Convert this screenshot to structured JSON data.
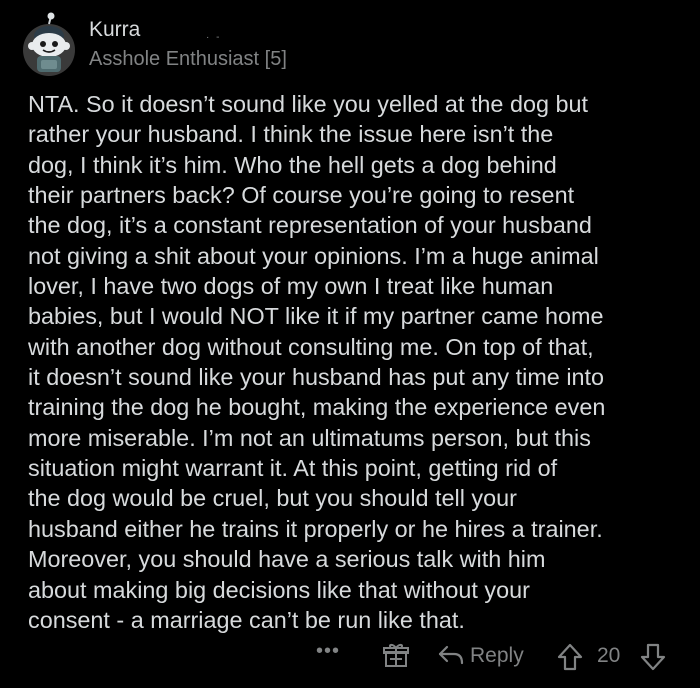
{
  "comment": {
    "author": "Kurra",
    "author_extra": "·  ‐",
    "flair": "Asshole Enthusiast [5]",
    "body_lines": [
      "NTA. So it doesn’t sound like you yelled at the dog but",
      "rather your husband. I think the issue here isn’t the",
      "dog, I think it’s him. Who the hell gets a dog behind",
      "their partners back? Of course you’re going to resent",
      "the dog, it’s a constant representation of your husband",
      "not giving a shit about your opinions. I’m a huge animal",
      "lover, I have two dogs of my own I treat like human",
      "babies, but I would NOT like it if my partner came home",
      "with another dog without consulting me. On top of that,",
      "it doesn’t sound like your husband has put any time into",
      "training the dog he bought, making the experience even",
      "more miserable. I’m not an ultimatums person, but this",
      "situation might warrant it. At this point, getting rid of",
      "the dog would be cruel, but you should tell your",
      "husband either he trains it properly or he hires a trainer.",
      "Moreover, you should have a serious talk with him",
      "about making big decisions like that without your",
      "consent - a marriage can’t be run like that."
    ]
  },
  "actions": {
    "more_label": "•••",
    "reply_label": "Reply",
    "score": "20"
  },
  "icons": {
    "avatar": "snoo-avatar-icon",
    "award": "gift-icon",
    "reply": "reply-arrow-icon",
    "upvote": "upvote-arrow-icon",
    "downvote": "downvote-arrow-icon"
  },
  "colors": {
    "background": "#000000",
    "text": "#d7dadc",
    "muted": "#818384"
  }
}
